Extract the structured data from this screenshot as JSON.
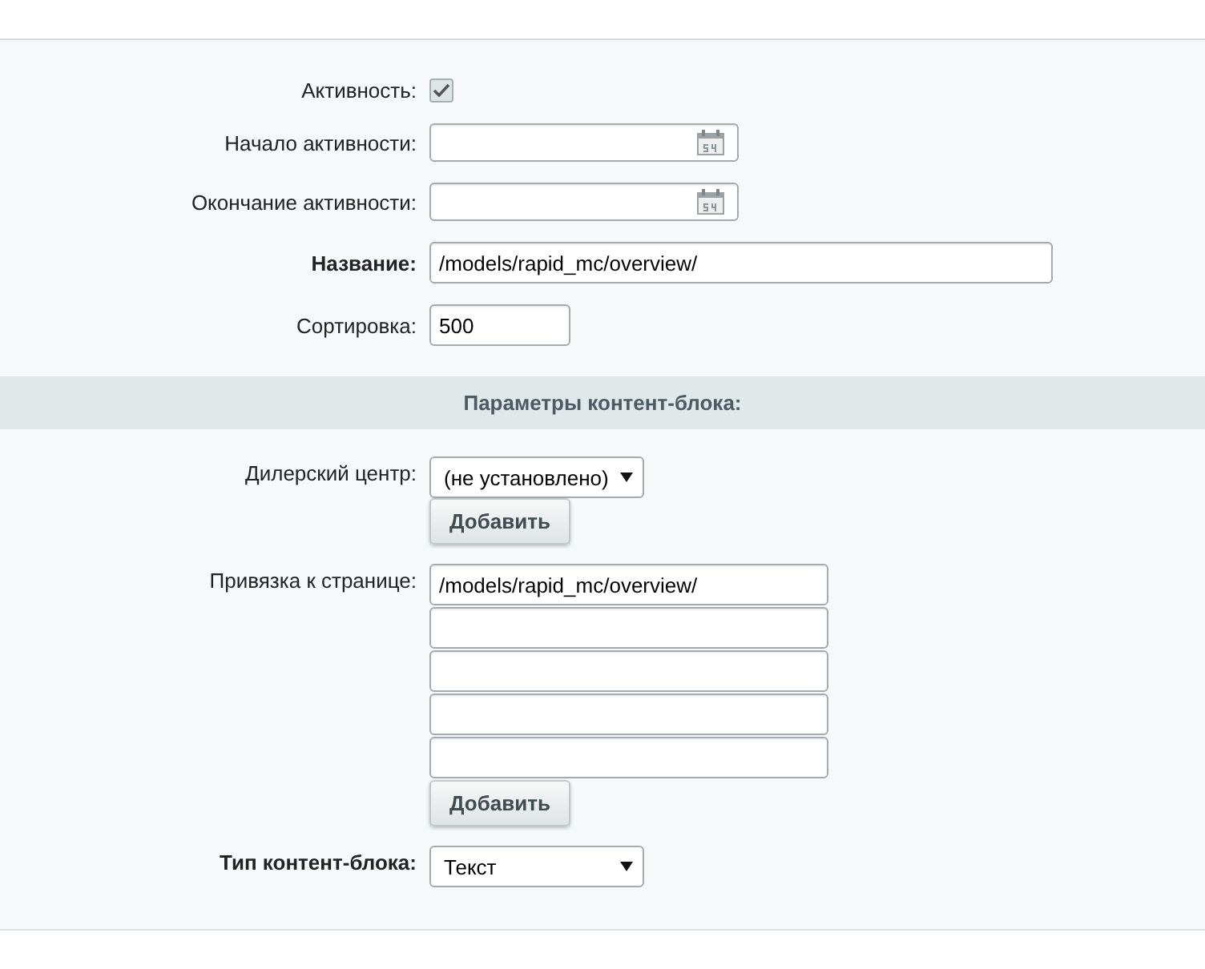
{
  "sections": [
    {
      "kind": "plain",
      "fields": [
        {
          "kind": "checkbox",
          "label": "Активность:",
          "required": false,
          "checked": true
        },
        {
          "kind": "date",
          "label": "Начало активности:",
          "required": false
        },
        {
          "kind": "date",
          "label": "Окончание активности:",
          "required": false
        },
        {
          "kind": "text",
          "label": "Название:",
          "required": true,
          "value": "/models/rapid_mc/overview/"
        },
        {
          "kind": "number",
          "label": "Сортировка:",
          "required": false,
          "value": "500"
        }
      ]
    },
    {
      "kind": "titled",
      "title": "Параметры контент-блока:",
      "fields": [
        {
          "kind": "select",
          "label": "Дилерский центр:",
          "required": false,
          "value": "(не установлено)",
          "button": "Добавить"
        },
        {
          "kind": "multi",
          "label": "Привязка к странице:",
          "required": false,
          "inputs": [
            {
              "kind": "filled",
              "value": "/models/rapid_mc/overview/"
            },
            {
              "kind": "empty"
            },
            {
              "kind": "empty"
            },
            {
              "kind": "empty"
            },
            {
              "kind": "empty"
            }
          ],
          "button": "Добавить"
        },
        {
          "kind": "select",
          "label": "Тип контент-блока:",
          "required": true,
          "value": "Текст"
        }
      ]
    }
  ]
}
